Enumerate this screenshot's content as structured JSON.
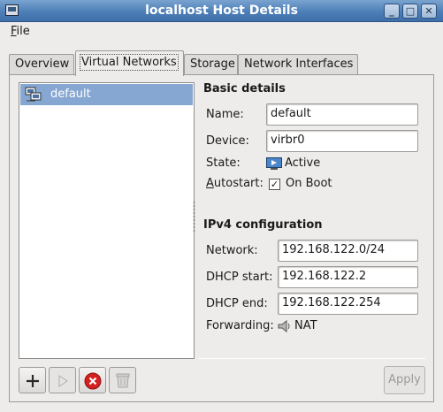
{
  "window": {
    "title": "localhost Host Details"
  },
  "menu": {
    "file_prefix": "",
    "file_accel": "F",
    "file_rest": "ile"
  },
  "tabs": [
    {
      "label": "Overview"
    },
    {
      "label": "Virtual Networks"
    },
    {
      "label": "Storage"
    },
    {
      "label": "Network Interfaces"
    }
  ],
  "networks": [
    {
      "name": "default"
    }
  ],
  "basic": {
    "title": "Basic details",
    "name_label": "Name:",
    "name_value": "default",
    "device_label": "Device:",
    "device_value": "virbr0",
    "state_label": "State:",
    "state_value": "Active",
    "autostart_accel": "A",
    "autostart_rest": "utostart:",
    "autostart_value": "On Boot",
    "autostart_checked": true
  },
  "ipv4": {
    "title": "IPv4 configuration",
    "network_label": "Network:",
    "network_value": "192.168.122.0/24",
    "dhcp_start_label": "DHCP start:",
    "dhcp_start_value": "192.168.122.2",
    "dhcp_end_label": "DHCP end:",
    "dhcp_end_value": "192.168.122.254",
    "forwarding_label": "Forwarding:",
    "forwarding_value": "NAT"
  },
  "buttons": {
    "apply": "Apply"
  },
  "colors": {
    "selection": "#86a7d2",
    "titlebar": "#4d7fb8",
    "delete": "#d42020"
  }
}
